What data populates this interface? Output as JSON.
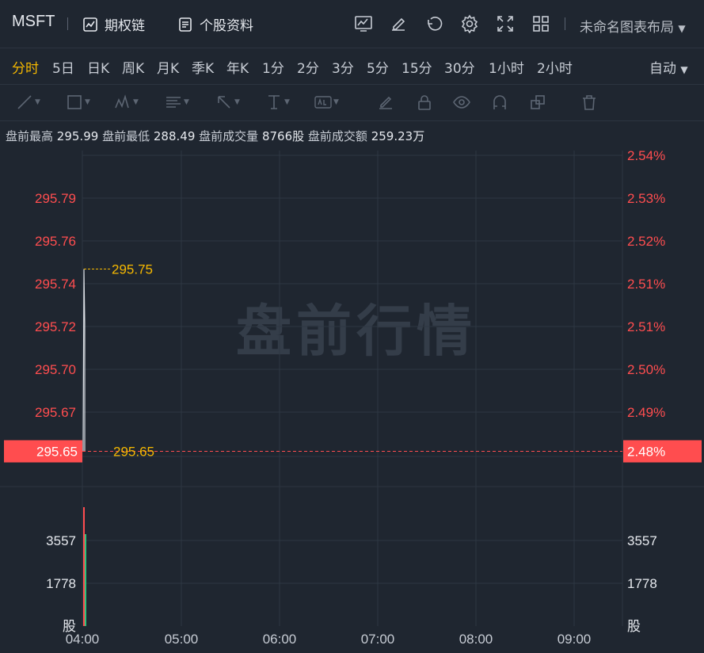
{
  "header": {
    "symbol": "MSFT",
    "option_chain_label": "期权链",
    "profile_label": "个股资料",
    "layout_label": "未命名图表布局"
  },
  "icons": [
    "chart-indicator-icon",
    "edit-icon",
    "undo-icon",
    "settings-icon",
    "fullscreen-icon",
    "grid-layout-icon"
  ],
  "periods": {
    "items": [
      "分时",
      "5日",
      "日K",
      "周K",
      "月K",
      "季K",
      "年K",
      "1分",
      "2分",
      "3分",
      "5分",
      "15分",
      "30分",
      "1小时",
      "2小时"
    ],
    "active": "分时",
    "auto_label": "自动"
  },
  "info": {
    "high_label": "盘前最高",
    "high": "295.99",
    "low_label": "盘前最低",
    "low": "288.49",
    "vol_label": "盘前成交量",
    "vol": "8766股",
    "amt_label": "盘前成交额",
    "amt": "259.23万"
  },
  "watermark": "盘前行情",
  "colors": {
    "up": "#ff4d4f",
    "down": "#2ec27e",
    "accent": "#f5b800",
    "line": "#d9dde3"
  },
  "chart_data": {
    "type": "line",
    "x_ticks": [
      "04:00",
      "05:00",
      "06:00",
      "07:00",
      "08:00",
      "09:00"
    ],
    "price_ticks": [
      "295.79",
      "295.76",
      "295.74",
      "295.72",
      "295.70",
      "295.67"
    ],
    "pct_ticks": [
      "2.54%",
      "2.53%",
      "2.52%",
      "2.51%",
      "2.51%",
      "2.50%",
      "2.49%"
    ],
    "current_price": "295.65",
    "current_pct": "2.48%",
    "max_marker": "295.75",
    "min_marker": "295.65",
    "volume_ticks": [
      "3557",
      "1778"
    ],
    "volume_unit": "股",
    "price_series": [
      295.65,
      295.75,
      295.72,
      295.65
    ],
    "price_range": [
      295.635,
      295.815
    ]
  }
}
